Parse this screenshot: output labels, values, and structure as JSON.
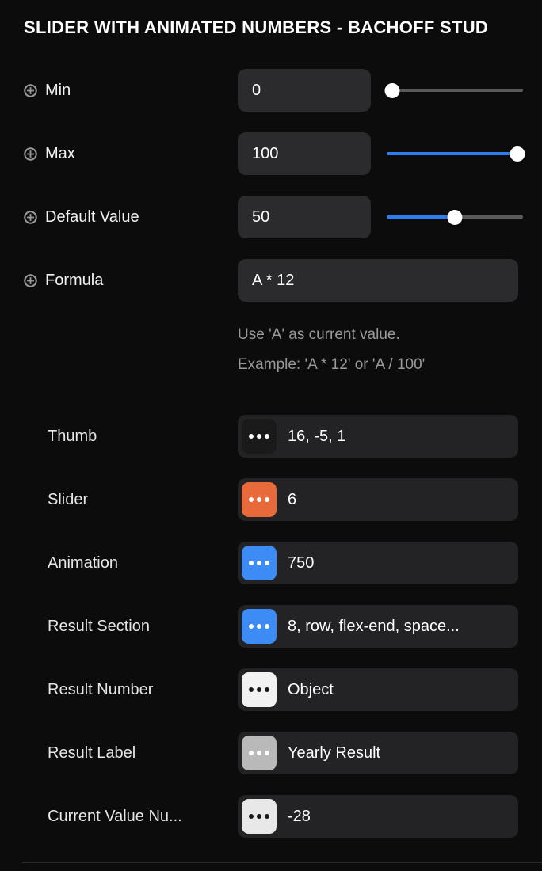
{
  "header": {
    "title": "SLIDER WITH ANIMATED NUMBERS - BACHOFF STUD"
  },
  "properties": [
    {
      "label": "Min",
      "icon": "plus-circle-icon",
      "value": "0",
      "slider": {
        "percent": 0,
        "filled": false
      }
    },
    {
      "label": "Max",
      "icon": "plus-circle-icon",
      "value": "100",
      "slider": {
        "percent": 100,
        "filled": true
      }
    },
    {
      "label": "Default Value",
      "icon": "plus-circle-icon",
      "value": "50",
      "slider": {
        "percent": 50,
        "filled": true
      }
    },
    {
      "label": "Formula",
      "icon": "plus-circle-icon",
      "value": "A * 12",
      "slider": null
    }
  ],
  "helper": {
    "line1": "Use 'A' as current value.",
    "line2": "Example: 'A * 12' or 'A / 100'"
  },
  "styles": [
    {
      "label": "Thumb",
      "badge_color": "#1a1a1a",
      "dot_color": "#ffffff",
      "value": "16, -5, 1"
    },
    {
      "label": "Slider",
      "badge_color": "#e8693a",
      "dot_color": "#ffffff",
      "value": "6"
    },
    {
      "label": "Animation",
      "badge_color": "#3d8bf5",
      "dot_color": "#ffffff",
      "value": "750"
    },
    {
      "label": "Result Section",
      "badge_color": "#3d8bf5",
      "dot_color": "#ffffff",
      "value": "8, row, flex-end, space..."
    },
    {
      "label": "Result Number",
      "badge_color": "#f2f2f2",
      "dot_color": "#1a1a1a",
      "value": "Object"
    },
    {
      "label": "Result Label",
      "badge_color": "#b9b9b9",
      "dot_color": "#ffffff",
      "value": "Yearly Result"
    },
    {
      "label": "Current Value Nu...",
      "badge_color": "#e8e8e8",
      "dot_color": "#1a1a1a",
      "value": "-28"
    }
  ],
  "colors": {
    "background": "#0c0c0c",
    "field": "#2b2b2d",
    "style_field": "#232325",
    "slider_fill": "#2e7ded",
    "slider_track": "#5a5a5a",
    "accent_orange": "#e8693a",
    "accent_blue": "#3d8bf5",
    "helper_text": "#9a9a9a"
  }
}
